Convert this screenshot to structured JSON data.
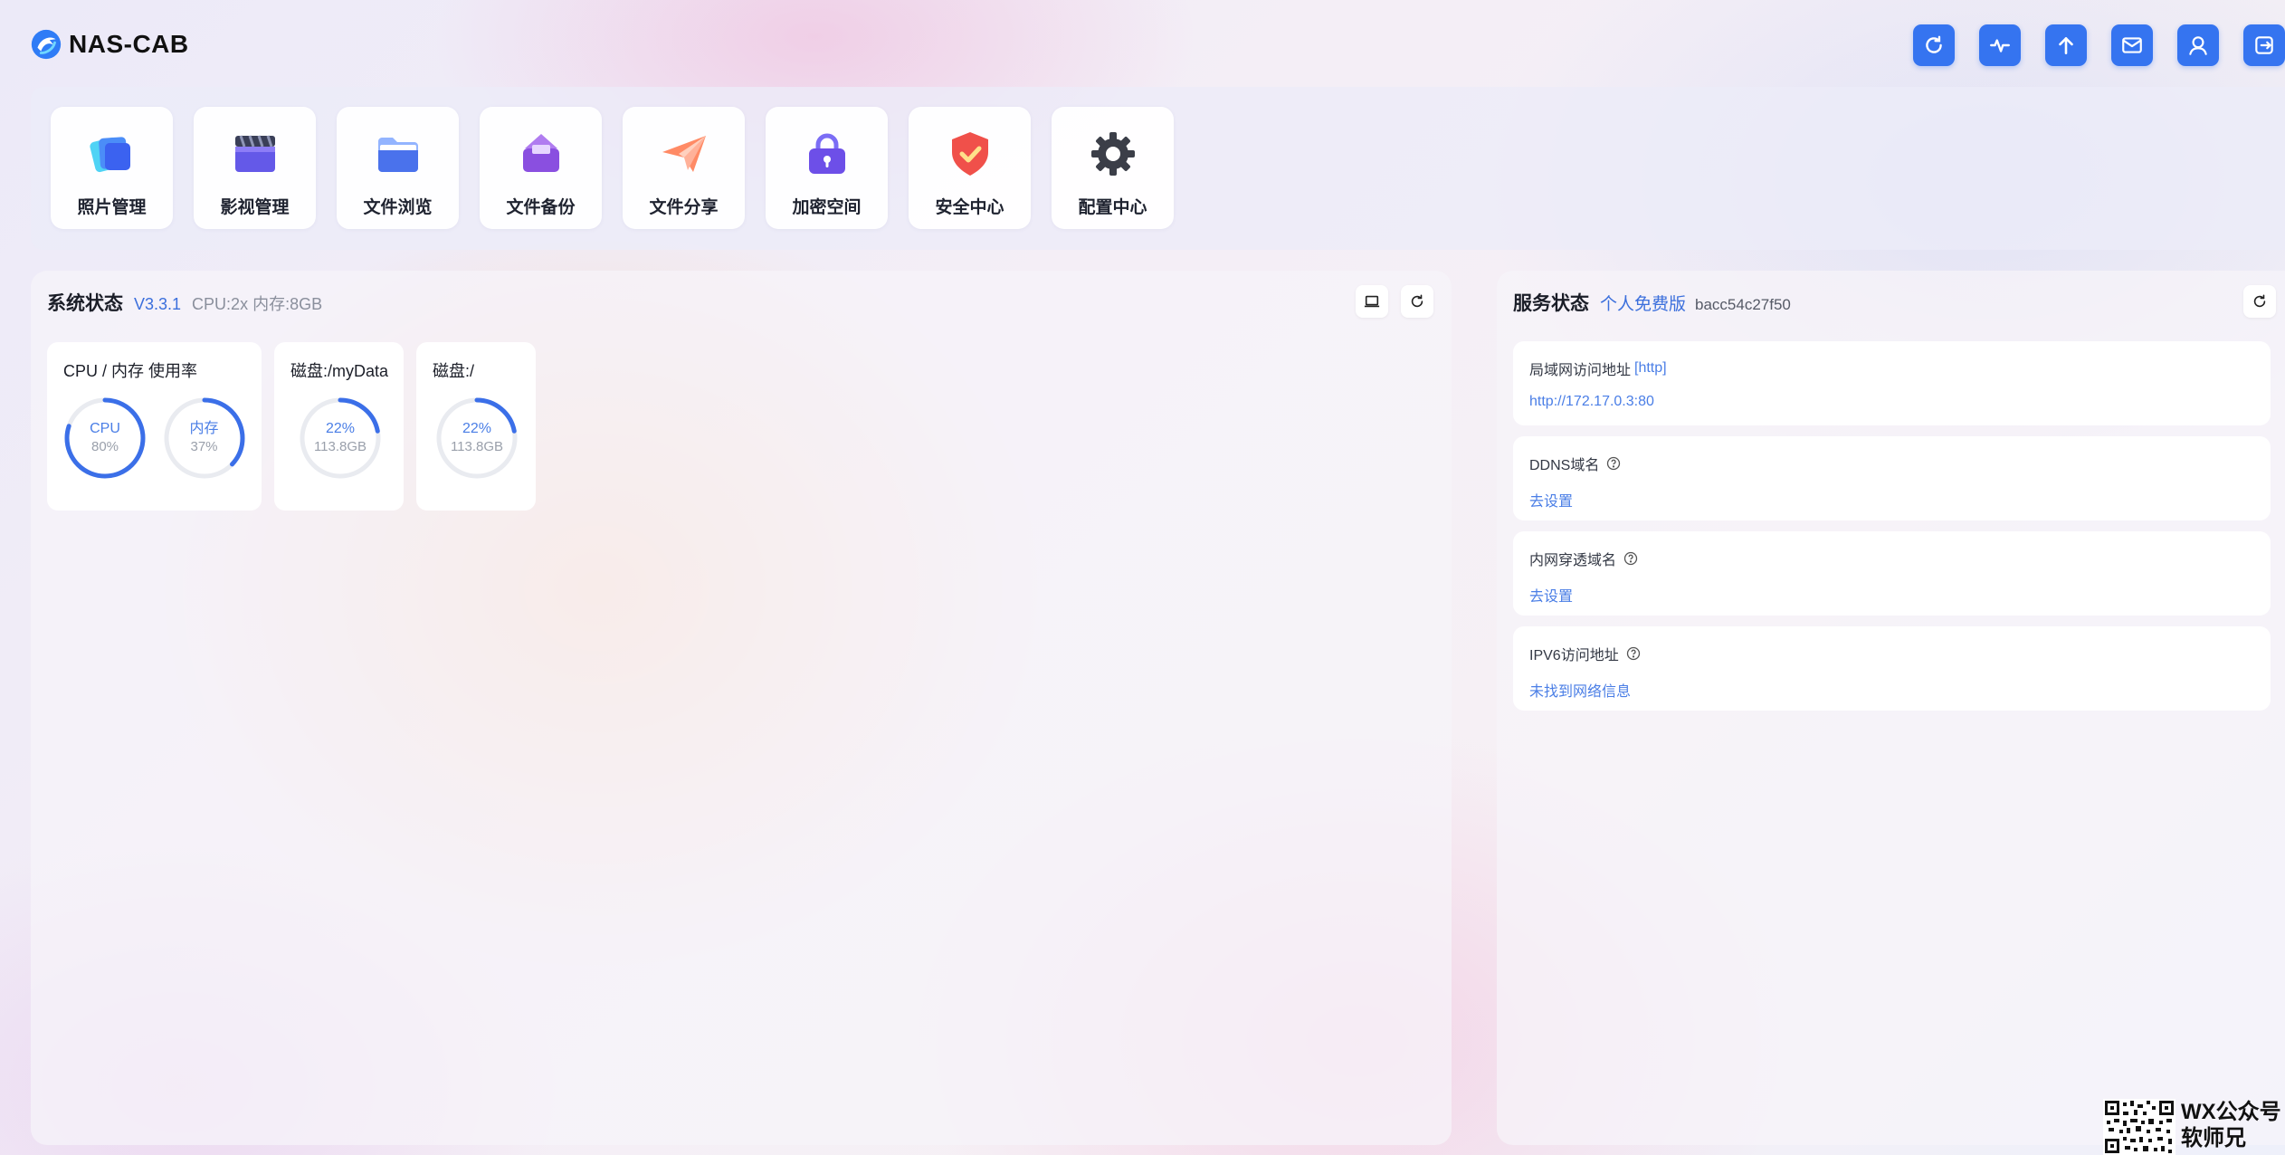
{
  "app": {
    "name": "NAS-CAB",
    "accent_color": "#3574f0"
  },
  "header": {
    "actions": [
      {
        "name": "refresh",
        "icon": "refresh-icon"
      },
      {
        "name": "activity",
        "icon": "pulse-icon"
      },
      {
        "name": "upload",
        "icon": "upload-arrow-icon"
      },
      {
        "name": "messages",
        "icon": "mail-icon"
      },
      {
        "name": "user",
        "icon": "user-icon"
      },
      {
        "name": "logout",
        "icon": "logout-icon"
      }
    ]
  },
  "apps": [
    {
      "label": "照片管理",
      "icon": "photos-icon"
    },
    {
      "label": "影视管理",
      "icon": "video-icon"
    },
    {
      "label": "文件浏览",
      "icon": "folder-icon"
    },
    {
      "label": "文件备份",
      "icon": "backup-icon"
    },
    {
      "label": "文件分享",
      "icon": "paper-plane-icon"
    },
    {
      "label": "加密空间",
      "icon": "lock-icon"
    },
    {
      "label": "安全中心",
      "icon": "shield-icon"
    },
    {
      "label": "配置中心",
      "icon": "gear-icon"
    }
  ],
  "system": {
    "title": "系统状态",
    "version": "V3.3.1",
    "spec": "CPU:2x 内存:8GB",
    "cards": {
      "usage": {
        "title": "CPU / 内存 使用率",
        "cpu": {
          "label": "CPU",
          "value": "80%",
          "fraction": 0.8
        },
        "mem": {
          "label": "内存",
          "value": "37%",
          "fraction": 0.37
        }
      },
      "disk1": {
        "title": "磁盘:/myData",
        "percent": "22%",
        "size": "113.8GB",
        "fraction": 0.22
      },
      "disk2": {
        "title": "磁盘:/",
        "percent": "22%",
        "size": "113.8GB",
        "fraction": 0.22
      }
    }
  },
  "service": {
    "title": "服务状态",
    "edition": "个人免费版",
    "id": "bacc54c27f50",
    "items": [
      {
        "label": "局域网访问地址",
        "tag": "[http]",
        "value": "http://172.17.0.3:80"
      },
      {
        "label": "DDNS域名",
        "value": "去设置"
      },
      {
        "label": "内网穿透域名",
        "value": "去设置"
      },
      {
        "label": "IPV6访问地址",
        "value": "未找到网络信息"
      }
    ]
  },
  "watermark": {
    "line1": "WX公众号",
    "line2": "软师兄"
  }
}
